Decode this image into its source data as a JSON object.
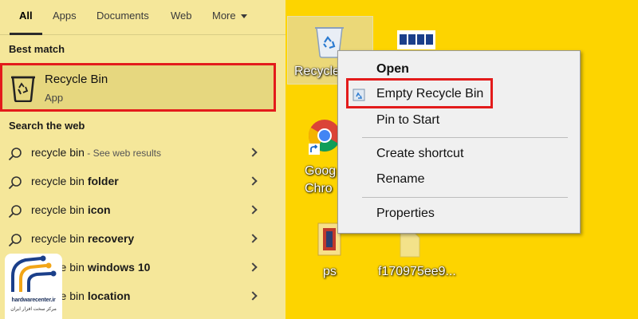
{
  "search": {
    "tabs": [
      {
        "label": "All",
        "active": true
      },
      {
        "label": "Apps"
      },
      {
        "label": "Documents"
      },
      {
        "label": "Web"
      },
      {
        "label": "More"
      }
    ],
    "best_match_heading": "Best match",
    "best_match": {
      "title": "Recycle Bin",
      "subtitle": "App"
    },
    "web_heading": "Search the web",
    "web_results": [
      {
        "query": "recycle bin",
        "bold": "",
        "suffix": " - See web results"
      },
      {
        "query": "recycle bin ",
        "bold": "folder",
        "suffix": ""
      },
      {
        "query": "recycle bin ",
        "bold": "icon",
        "suffix": ""
      },
      {
        "query": "recycle bin ",
        "bold": "recovery",
        "suffix": ""
      },
      {
        "query": "recycle bin ",
        "bold": "windows 10",
        "suffix": ""
      },
      {
        "query": "recycle bin ",
        "bold": "location",
        "suffix": ""
      }
    ]
  },
  "desktop": {
    "recycle_label": "Recycle",
    "chrome_label_1": "Goog",
    "chrome_label_2": "Chro",
    "ps_label": "ps",
    "file_label": "f170975ee9..."
  },
  "context_menu": {
    "items": [
      {
        "label": "Open",
        "default": true
      },
      {
        "label": "Empty Recycle Bin",
        "highlighted": true
      },
      {
        "label": "Pin to Start"
      },
      {
        "label": "Create shortcut"
      },
      {
        "label": "Rename"
      },
      {
        "label": "Properties"
      }
    ]
  },
  "logo": {
    "name": "hardwarecenter.ir",
    "tagline": "مرکز سخت افزار ایران"
  },
  "colors": {
    "desktop_bg": "#fdd400",
    "panel_bg": "#f5e79a",
    "highlight_red": "#e31b1b",
    "selected_bg": "#e6d77f"
  }
}
